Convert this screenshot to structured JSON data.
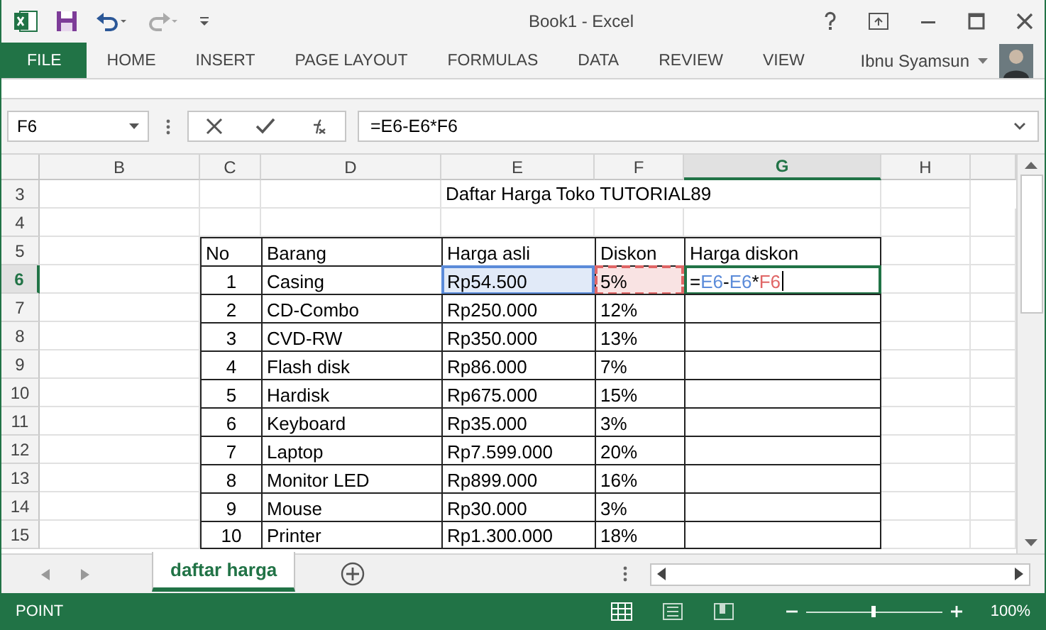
{
  "window": {
    "title": "Book1 - Excel"
  },
  "ribbon_tabs": [
    {
      "label": "FILE",
      "selected": true
    },
    {
      "label": "HOME",
      "selected": false
    },
    {
      "label": "INSERT",
      "selected": false
    },
    {
      "label": "PAGE LAYOUT",
      "selected": false
    },
    {
      "label": "FORMULAS",
      "selected": false
    },
    {
      "label": "DATA",
      "selected": false
    },
    {
      "label": "REVIEW",
      "selected": false
    },
    {
      "label": "VIEW",
      "selected": false
    }
  ],
  "user": {
    "name": "Ibnu Syamsun"
  },
  "formula_bar": {
    "name_box": "F6",
    "formula": "=E6-E6*F6"
  },
  "columns": [
    {
      "label": "B",
      "selected": false
    },
    {
      "label": "C",
      "selected": false
    },
    {
      "label": "D",
      "selected": false
    },
    {
      "label": "E",
      "selected": false
    },
    {
      "label": "F",
      "selected": false
    },
    {
      "label": "G",
      "selected": true
    },
    {
      "label": "H",
      "selected": false
    }
  ],
  "rows": [
    {
      "number": "3",
      "selected": false,
      "kind": "title",
      "text": "Daftar Harga Toko TUTORIAL89"
    },
    {
      "number": "4",
      "selected": false,
      "kind": "blank"
    },
    {
      "number": "5",
      "selected": false,
      "kind": "header",
      "cells": [
        {
          "text": "No"
        },
        {
          "text": "Barang"
        },
        {
          "text": "Harga asli"
        },
        {
          "text": "Diskon"
        },
        {
          "text": "Harga diskon"
        }
      ]
    },
    {
      "number": "6",
      "selected": true,
      "kind": "data",
      "cells": [
        {
          "text": "1"
        },
        {
          "text": "Casing"
        },
        {
          "text": "Rp54.500",
          "color": "#5b8bd9"
        },
        {
          "text": "5%",
          "color": "#e06666"
        },
        {
          "formula": [
            {
              "text": "=",
              "color": "#000000"
            },
            {
              "text": "E6",
              "color": "#5b8bd9"
            },
            {
              "text": "-",
              "color": "#000000"
            },
            {
              "text": "E6",
              "color": "#5b8bd9"
            },
            {
              "text": "*",
              "color": "#000000"
            },
            {
              "text": "F6",
              "color": "#e06666"
            }
          ]
        }
      ]
    },
    {
      "number": "7",
      "selected": false,
      "kind": "data",
      "cells": [
        {
          "text": "2"
        },
        {
          "text": "CD-Combo"
        },
        {
          "text": "Rp250.000"
        },
        {
          "text": "12%"
        },
        {}
      ]
    },
    {
      "number": "8",
      "selected": false,
      "kind": "data",
      "cells": [
        {
          "text": "3"
        },
        {
          "text": "CVD-RW"
        },
        {
          "text": "Rp350.000"
        },
        {
          "text": "13%"
        },
        {}
      ]
    },
    {
      "number": "9",
      "selected": false,
      "kind": "data",
      "cells": [
        {
          "text": "4"
        },
        {
          "text": "Flash disk"
        },
        {
          "text": "Rp86.000"
        },
        {
          "text": "7%"
        },
        {}
      ]
    },
    {
      "number": "10",
      "selected": false,
      "kind": "data",
      "cells": [
        {
          "text": "5"
        },
        {
          "text": "Hardisk"
        },
        {
          "text": "Rp675.000"
        },
        {
          "text": "15%"
        },
        {}
      ]
    },
    {
      "number": "11",
      "selected": false,
      "kind": "data",
      "cells": [
        {
          "text": "6"
        },
        {
          "text": "Keyboard"
        },
        {
          "text": "Rp35.000"
        },
        {
          "text": "3%"
        },
        {}
      ]
    },
    {
      "number": "12",
      "selected": false,
      "kind": "data",
      "cells": [
        {
          "text": "7"
        },
        {
          "text": "Laptop"
        },
        {
          "text": "Rp7.599.000"
        },
        {
          "text": "20%"
        },
        {}
      ]
    },
    {
      "number": "13",
      "selected": false,
      "kind": "data",
      "cells": [
        {
          "text": "8"
        },
        {
          "text": "Monitor LED"
        },
        {
          "text": "Rp899.000"
        },
        {
          "text": "16%"
        },
        {}
      ]
    },
    {
      "number": "14",
      "selected": false,
      "kind": "data",
      "cells": [
        {
          "text": "9"
        },
        {
          "text": "Mouse"
        },
        {
          "text": "Rp30.000"
        },
        {
          "text": "3%"
        },
        {}
      ]
    },
    {
      "number": "15",
      "selected": false,
      "kind": "data",
      "cells": [
        {
          "text": "10"
        },
        {
          "text": "Printer"
        },
        {
          "text": "Rp1.300.000"
        },
        {
          "text": "18%"
        },
        {}
      ]
    }
  ],
  "sheet_tabs": [
    {
      "label": "daftar harga",
      "selected": true
    }
  ],
  "status_bar": {
    "mode": "POINT",
    "zoom": "100%",
    "zoom_slider": {
      "level": 0.5
    },
    "views": [
      {
        "selected": true
      },
      {
        "selected": false
      },
      {
        "selected": false
      }
    ]
  }
}
